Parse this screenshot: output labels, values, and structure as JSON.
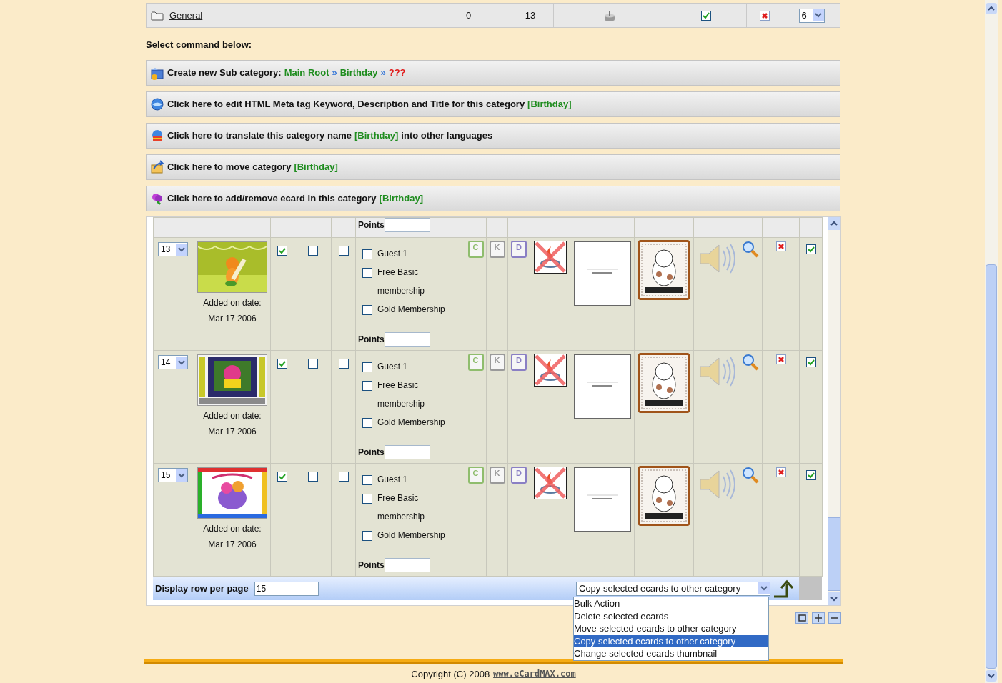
{
  "category_row": {
    "name": "General",
    "column_2": "0",
    "column_3": "13",
    "active": true,
    "order": "6"
  },
  "commands_label": "Select command below:",
  "commands": [
    {
      "kind": "new-folder",
      "parts": [
        {
          "kind": "plain",
          "text": "Create new Sub category:"
        },
        {
          "kind": "path",
          "text": "Main Root"
        },
        {
          "kind": "separator",
          "text": "»"
        },
        {
          "kind": "path",
          "text": "Birthday"
        },
        {
          "kind": "separator",
          "text": "»"
        },
        {
          "kind": "unknown",
          "text": "???"
        }
      ]
    },
    {
      "kind": "globe",
      "parts": [
        {
          "kind": "plain",
          "text": "Click here to edit HTML Meta tag Keyword, Description and Title for this category"
        },
        {
          "kind": "path",
          "text": "[Birthday]"
        }
      ]
    },
    {
      "kind": "translate",
      "parts": [
        {
          "kind": "plain",
          "text": "Click here to translate this category name"
        },
        {
          "kind": "path",
          "text": "[Birthday]"
        },
        {
          "kind": "plain",
          "text": "into other languages"
        }
      ]
    },
    {
      "kind": "move",
      "parts": [
        {
          "kind": "plain",
          "text": "Click here to move category"
        },
        {
          "kind": "path",
          "text": "[Birthday]"
        }
      ]
    },
    {
      "kind": "flower",
      "parts": [
        {
          "kind": "plain",
          "text": "Click here to add/remove ecard in this category"
        },
        {
          "kind": "path",
          "text": "[Birthday]"
        }
      ]
    }
  ],
  "table": {
    "header_points_label": "Points",
    "rows": [
      {
        "order": "13",
        "added_label": "Added on date:",
        "date": "Mar 17 2006",
        "flags": [
          true,
          false,
          false
        ],
        "memberships": [
          {
            "label": "Guest 1",
            "checked": false
          },
          {
            "label": "Free Basic membership",
            "checked": false
          },
          {
            "label": "Gold Membership",
            "checked": false
          }
        ],
        "points_label": "Points",
        "key_buttons": [
          {
            "label": "C",
            "color": "#8fbd6d"
          },
          {
            "label": "K",
            "color": "#9a9a9a"
          },
          {
            "label": "D",
            "color": "#8a7fc4"
          }
        ],
        "selected": true
      },
      {
        "order": "14",
        "added_label": "Added on date:",
        "date": "Mar 17 2006",
        "flags": [
          true,
          false,
          false
        ],
        "memberships": [
          {
            "label": "Guest 1",
            "checked": false
          },
          {
            "label": "Free Basic membership",
            "checked": false
          },
          {
            "label": "Gold Membership",
            "checked": false
          }
        ],
        "points_label": "Points",
        "key_buttons": [
          {
            "label": "C",
            "color": "#8fbd6d"
          },
          {
            "label": "K",
            "color": "#9a9a9a"
          },
          {
            "label": "D",
            "color": "#8a7fc4"
          }
        ],
        "selected": true
      },
      {
        "order": "15",
        "added_label": "Added on date:",
        "date": "Mar 17 2006",
        "flags": [
          true,
          false,
          false
        ],
        "memberships": [
          {
            "label": "Guest 1",
            "checked": false
          },
          {
            "label": "Free Basic membership",
            "checked": false
          },
          {
            "label": "Gold Membership",
            "checked": false
          }
        ],
        "points_label": "Points",
        "key_buttons": [
          {
            "label": "C",
            "color": "#8fbd6d"
          },
          {
            "label": "K",
            "color": "#9a9a9a"
          },
          {
            "label": "D",
            "color": "#8a7fc4"
          }
        ],
        "selected": true
      }
    ],
    "footer": {
      "rows_label": "Display row per page",
      "rows_value": "15",
      "bulk_action": {
        "value": "Copy selected ecards to other category",
        "options": [
          {
            "label": "Bulk Action",
            "selected": false
          },
          {
            "label": "Delete selected ecards",
            "selected": false
          },
          {
            "label": "Move selected ecards to other category",
            "selected": false
          },
          {
            "label": "Copy selected ecards to other category",
            "selected": true
          },
          {
            "label": "Change selected ecards thumbnail",
            "selected": false
          }
        ]
      }
    }
  },
  "copyright": {
    "text": "Copyright (C) 2008",
    "link": "www.eCardMAX.com"
  }
}
